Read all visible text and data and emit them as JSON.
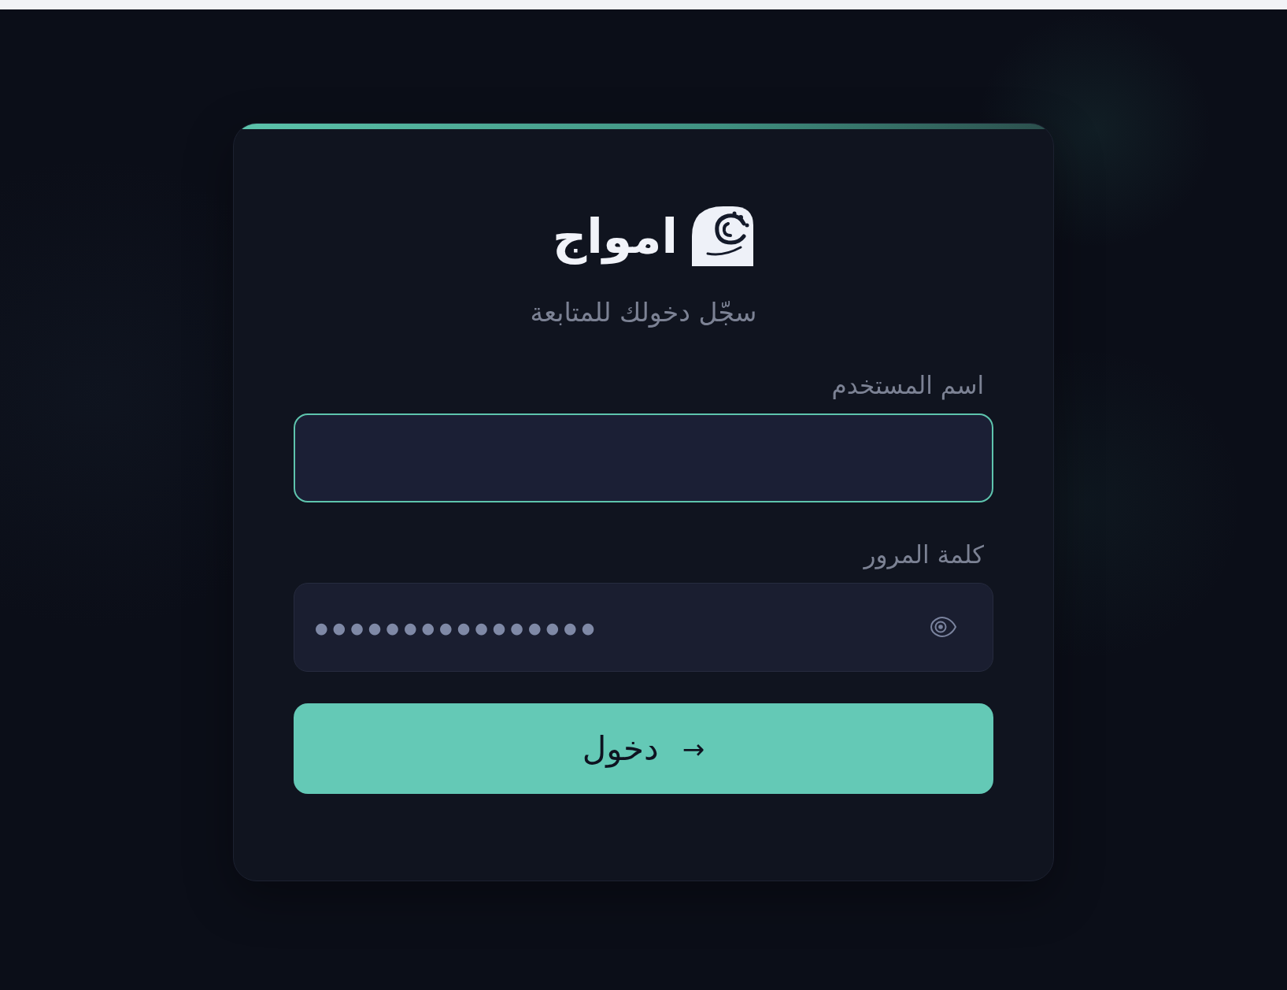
{
  "brand": {
    "name": "امواج"
  },
  "subtitle": "سجّل دخولك للمتابعة",
  "fields": [
    {
      "kind": "text",
      "label": "اسم المستخدم",
      "focused": true
    },
    {
      "kind": "password",
      "label": "كلمة المرور",
      "value": "●●●●●●●●●●●●●●●●",
      "focused": false
    }
  ],
  "submit_button": {
    "label": "دخول",
    "icon": "→"
  }
}
